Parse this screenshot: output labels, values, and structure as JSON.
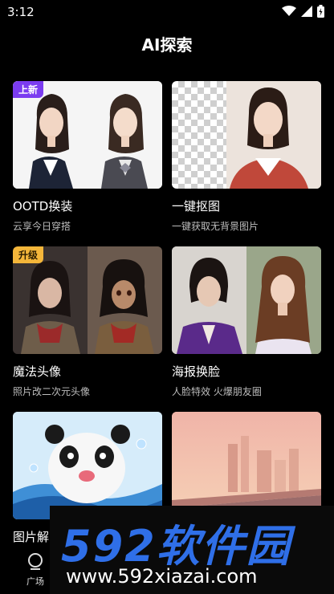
{
  "status": {
    "time": "3:12"
  },
  "header": {
    "title": "AI探索"
  },
  "cards": [
    {
      "title": "OOTD换装",
      "subtitle": "云享今日穿搭",
      "badge": "上新"
    },
    {
      "title": "一键抠图",
      "subtitle": "一键获取无背景图片",
      "badge": ""
    },
    {
      "title": "魔法头像",
      "subtitle": "照片改二次元头像",
      "badge": "升级"
    },
    {
      "title": "海报换脸",
      "subtitle": "人脸特效 火爆朋友圈",
      "badge": ""
    },
    {
      "title": "图片解",
      "subtitle": "",
      "badge": ""
    },
    {
      "title": "",
      "subtitle": "",
      "badge": ""
    }
  ],
  "tabbar": {
    "items": [
      {
        "label": "广场",
        "icon": "plaza-icon"
      }
    ]
  },
  "watermark": {
    "brand": "592软件园",
    "url": "www.592xiazai.com"
  }
}
